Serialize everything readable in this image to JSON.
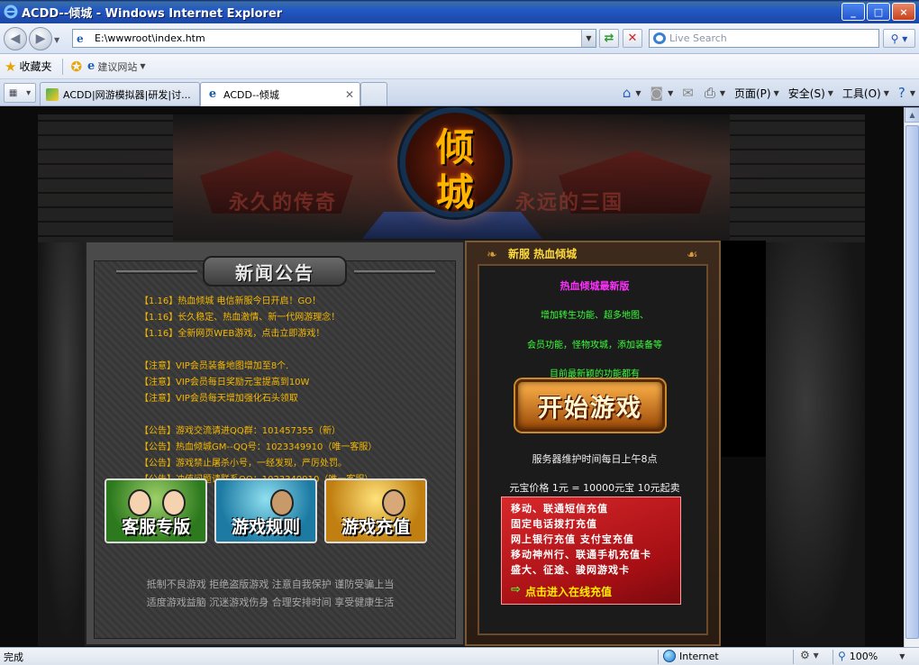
{
  "window": {
    "title": "ACDD--倾城 - Windows Internet Explorer",
    "minimize": "_",
    "maximize": "□",
    "close": "×"
  },
  "address": {
    "url": "E:\\wwwroot\\index.htm",
    "search_placeholder": "Live Search"
  },
  "favorites": {
    "label": "收藏夹",
    "suggested_sites": "建议网站"
  },
  "tabs": [
    {
      "label": "ACDD|网游模拟器|研发|讨...",
      "active": false
    },
    {
      "label": "ACDD--倾城",
      "active": true
    }
  ],
  "commandbar": {
    "page": "页面(P)",
    "safety": "安全(S)",
    "tools": "工具(O)"
  },
  "page": {
    "logo_text": "倾城",
    "slogan_left": "永久的传奇",
    "slogan_right": "永远的三国",
    "news": {
      "title": "新闻公告",
      "items": [
        "【1.16】热血倾城 电信新服今日开启！GO！",
        "【1.16】长久稳定、热血激情、新一代网游理念！",
        "【1.16】全新网页WEB游戏，点击立即游戏！",
        "",
        "【注意】VIP会员装备地图增加至8个.",
        "【注意】VIP会员每日奖励元宝提高到10W",
        "【注意】VIP会员每天增加强化石头领取",
        "",
        "【公告】游戏交流请进QQ群：101457355（新）",
        "【公告】热血倾城GM--QQ号：1023349910（唯一客服）",
        "【公告】游戏禁止屠杀小号，一经发现，严厉处罚。",
        "【公告】冲值问题请联系QQ：1023349910（唯一客服）"
      ]
    },
    "buttons": {
      "customer_service": "客服专版",
      "game_rules": "游戏规则",
      "game_recharge": "游戏充值"
    },
    "slogans": [
      "抵制不良游戏 拒绝盗版游戏 注意自我保护 谨防受骗上当",
      "适度游戏益脑 沉迷游戏伤身 合理安排时间 享受健康生活"
    ],
    "promo": {
      "header": "新服 热血倾城",
      "subheader": "热血倾城最新版",
      "line1": "增加转生功能、超多地图、",
      "line2": "会员功能，怪物攻城，添加装备等",
      "line3": "目前最新颖的功能都有",
      "start_button": "开始游戏",
      "maintenance": "服务器维护时间每日上午8点",
      "price": "元宝价格 1元 = 10000元宝 10元起卖",
      "pay_lines": [
        "移动、联通短信充值",
        "固定电话拨打充值",
        "网上银行充值 支付宝充值",
        "移动神州行、联通手机充值卡",
        "盛大、征途、骏网游戏卡"
      ],
      "pay_cta": "点击进入在线充值"
    }
  },
  "status": {
    "text": "完成",
    "zone": "Internet",
    "zoom": "100%"
  }
}
